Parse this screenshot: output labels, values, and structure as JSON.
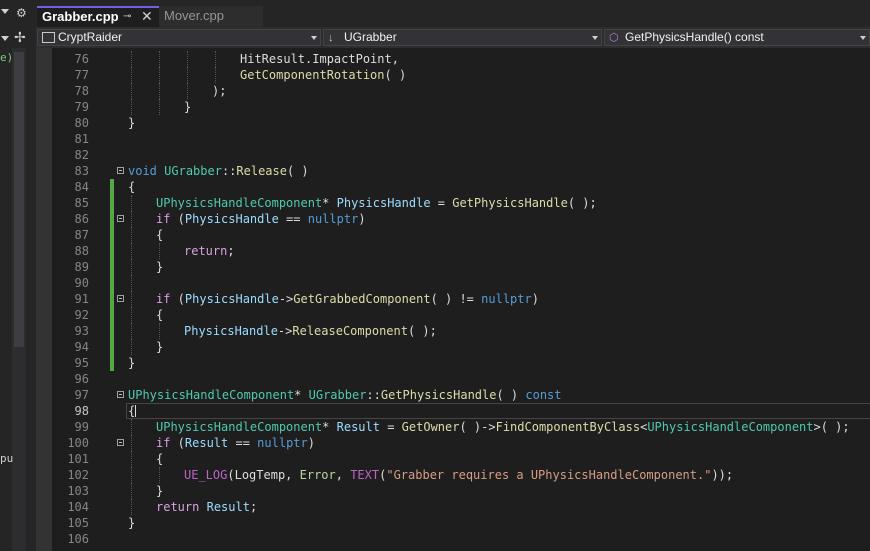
{
  "tabs": [
    {
      "label": "Grabber.cpp",
      "active": true
    },
    {
      "label": "Mover.cpp",
      "active": false
    }
  ],
  "nav": {
    "project": "CryptRaider",
    "class": "UGrabber",
    "member": "GetPhysicsHandle() const"
  },
  "left_strip": {
    "partial_label": "pu"
  },
  "colors": {
    "background": "#1e1e1e",
    "accent_tab": "#7160e8",
    "change_bar": "#57a64a",
    "keyword": "#569cd6",
    "type": "#4ec9b0",
    "function": "#dcdcaa",
    "string": "#d69d85"
  },
  "current_line": 98,
  "lines": [
    {
      "n": "76",
      "ind": 4,
      "seg": [
        [
          "tx",
          "HitResult.ImpactPoint,"
        ]
      ]
    },
    {
      "n": "77",
      "ind": 4,
      "seg": [
        [
          "fn",
          "GetComponentRotation"
        ],
        [
          "tx",
          "( )"
        ]
      ]
    },
    {
      "n": "78",
      "ind": 3,
      "seg": [
        [
          "tx",
          ");"
        ]
      ]
    },
    {
      "n": "79",
      "ind": 2,
      "seg": [
        [
          "tx",
          "}"
        ]
      ]
    },
    {
      "n": "80",
      "ind": 0,
      "seg": [
        [
          "tx",
          "}"
        ]
      ]
    },
    {
      "n": "81",
      "ind": 0,
      "seg": []
    },
    {
      "n": "82",
      "ind": 0,
      "seg": []
    },
    {
      "n": "83",
      "ind": 0,
      "fold": true,
      "seg": [
        [
          "kw",
          "void"
        ],
        [
          "tx",
          " "
        ],
        [
          "ty",
          "UGrabber"
        ],
        [
          "tx",
          "::"
        ],
        [
          "fn",
          "Release"
        ],
        [
          "tx",
          "( )"
        ]
      ]
    },
    {
      "n": "84",
      "ind": 0,
      "chg": true,
      "seg": [
        [
          "tx",
          "{"
        ]
      ]
    },
    {
      "n": "85",
      "ind": 1,
      "chg": true,
      "seg": [
        [
          "ty",
          "UPhysicsHandleComponent"
        ],
        [
          "tx",
          "* "
        ],
        [
          "var",
          "PhysicsHandle"
        ],
        [
          "tx",
          " = "
        ],
        [
          "fn",
          "GetPhysicsHandle"
        ],
        [
          "tx",
          "( );"
        ]
      ]
    },
    {
      "n": "86",
      "ind": 1,
      "chg": true,
      "fold": true,
      "seg": [
        [
          "ctl",
          "if"
        ],
        [
          "tx",
          " ("
        ],
        [
          "var",
          "PhysicsHandle"
        ],
        [
          "tx",
          " == "
        ],
        [
          "kw",
          "nullptr"
        ],
        [
          "tx",
          ")"
        ]
      ]
    },
    {
      "n": "87",
      "ind": 1,
      "chg": true,
      "seg": [
        [
          "tx",
          "{"
        ]
      ]
    },
    {
      "n": "88",
      "ind": 2,
      "chg": true,
      "seg": [
        [
          "ctl",
          "return"
        ],
        [
          "tx",
          ";"
        ]
      ]
    },
    {
      "n": "89",
      "ind": 1,
      "chg": true,
      "seg": [
        [
          "tx",
          "}"
        ]
      ]
    },
    {
      "n": "90",
      "ind": 1,
      "chg": true,
      "seg": []
    },
    {
      "n": "91",
      "ind": 1,
      "chg": true,
      "fold": true,
      "seg": [
        [
          "ctl",
          "if"
        ],
        [
          "tx",
          " ("
        ],
        [
          "var",
          "PhysicsHandle"
        ],
        [
          "tx",
          "->"
        ],
        [
          "fn",
          "GetGrabbedComponent"
        ],
        [
          "tx",
          "( ) != "
        ],
        [
          "kw",
          "nullptr"
        ],
        [
          "tx",
          ")"
        ]
      ]
    },
    {
      "n": "92",
      "ind": 1,
      "chg": true,
      "seg": [
        [
          "tx",
          "{"
        ]
      ]
    },
    {
      "n": "93",
      "ind": 2,
      "chg": true,
      "seg": [
        [
          "var",
          "PhysicsHandle"
        ],
        [
          "tx",
          "->"
        ],
        [
          "fn",
          "ReleaseComponent"
        ],
        [
          "tx",
          "( );"
        ]
      ]
    },
    {
      "n": "94",
      "ind": 1,
      "chg": true,
      "seg": [
        [
          "tx",
          "}"
        ]
      ]
    },
    {
      "n": "95",
      "ind": 0,
      "chg": true,
      "seg": [
        [
          "tx",
          "}"
        ]
      ]
    },
    {
      "n": "96",
      "ind": 0,
      "seg": []
    },
    {
      "n": "97",
      "ind": 0,
      "fold": true,
      "seg": [
        [
          "ty",
          "UPhysicsHandleComponent"
        ],
        [
          "tx",
          "* "
        ],
        [
          "ty",
          "UGrabber"
        ],
        [
          "tx",
          "::"
        ],
        [
          "fn",
          "GetPhysicsHandle"
        ],
        [
          "tx",
          "( ) "
        ],
        [
          "kw",
          "const"
        ]
      ]
    },
    {
      "n": "98",
      "ind": 0,
      "cur": true,
      "seg": [
        [
          "tx",
          "{"
        ]
      ]
    },
    {
      "n": "99",
      "ind": 1,
      "seg": [
        [
          "ty",
          "UPhysicsHandleComponent"
        ],
        [
          "tx",
          "* "
        ],
        [
          "var",
          "Result"
        ],
        [
          "tx",
          " = "
        ],
        [
          "fn",
          "GetOwner"
        ],
        [
          "tx",
          "( )->"
        ],
        [
          "fn",
          "FindComponentByClass"
        ],
        [
          "tx",
          "<"
        ],
        [
          "ty",
          "UPhysicsHandleComponent"
        ],
        [
          "tx",
          ">( );"
        ]
      ]
    },
    {
      "n": "100",
      "ind": 1,
      "fold": true,
      "seg": [
        [
          "ctl",
          "if"
        ],
        [
          "tx",
          " ("
        ],
        [
          "var",
          "Result"
        ],
        [
          "tx",
          " == "
        ],
        [
          "kw",
          "nullptr"
        ],
        [
          "tx",
          ")"
        ]
      ]
    },
    {
      "n": "101",
      "ind": 1,
      "seg": [
        [
          "tx",
          "{"
        ]
      ]
    },
    {
      "n": "102",
      "ind": 2,
      "seg": [
        [
          "mac",
          "UE_LOG"
        ],
        [
          "tx",
          "("
        ],
        [
          "tx",
          "LogTemp"
        ],
        [
          "tx",
          ", "
        ],
        [
          "vr2",
          "Error"
        ],
        [
          "tx",
          ", "
        ],
        [
          "mac",
          "TEXT"
        ],
        [
          "tx",
          "("
        ],
        [
          "str",
          "\"Grabber requires a UPhysicsHandleComponent.\""
        ],
        [
          "tx",
          "));"
        ]
      ]
    },
    {
      "n": "103",
      "ind": 1,
      "seg": [
        [
          "tx",
          "}"
        ]
      ]
    },
    {
      "n": "104",
      "ind": 1,
      "seg": [
        [
          "ctl",
          "return"
        ],
        [
          "tx",
          " "
        ],
        [
          "var",
          "Result"
        ],
        [
          "tx",
          ";"
        ]
      ]
    },
    {
      "n": "105",
      "ind": 0,
      "seg": [
        [
          "tx",
          "}"
        ]
      ]
    },
    {
      "n": "106",
      "ind": 0,
      "seg": []
    }
  ]
}
